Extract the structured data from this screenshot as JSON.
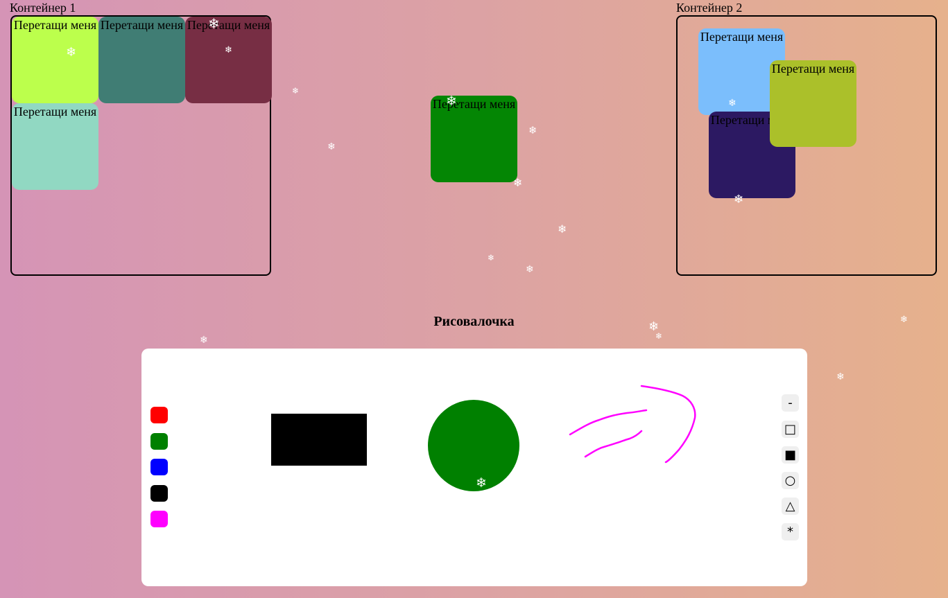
{
  "containers": [
    {
      "label": "Контейнер 1"
    },
    {
      "label": "Контейнер 2"
    }
  ],
  "cards": {
    "text": "Перетащи меня",
    "container1": [
      {
        "color": "#bcff4c"
      },
      {
        "color": "#407d74"
      },
      {
        "color": "#772e44"
      },
      {
        "color": "#91d8c2"
      }
    ],
    "free": [
      {
        "color": "#048604"
      }
    ],
    "container2": [
      {
        "color": "#7bbefc"
      },
      {
        "color": "#2c1962"
      },
      {
        "color": "#abc02a"
      }
    ]
  },
  "drawing": {
    "title": "Рисовалочка",
    "colors": [
      {
        "name": "red",
        "hex": "#ff0000"
      },
      {
        "name": "green",
        "hex": "#008000"
      },
      {
        "name": "blue",
        "hex": "#0000ff"
      },
      {
        "name": "black",
        "hex": "#000000"
      },
      {
        "name": "magenta",
        "hex": "#ff00ff"
      }
    ],
    "tools": [
      {
        "name": "line",
        "glyph": "-"
      },
      {
        "name": "rectangle",
        "glyph": "□"
      },
      {
        "name": "filled-rectangle",
        "glyph": "■"
      },
      {
        "name": "circle",
        "glyph": "○"
      },
      {
        "name": "triangle",
        "glyph": "△"
      },
      {
        "name": "freehand",
        "glyph": "*"
      }
    ],
    "shapes": {
      "rectangle_color": "#000000",
      "circle_color": "#008000",
      "stroke_color": "#ff00ff"
    }
  },
  "snowflake": "❄"
}
